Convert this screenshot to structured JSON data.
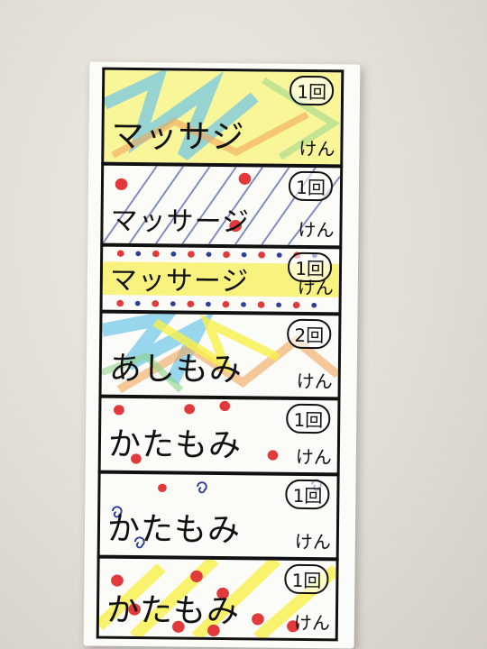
{
  "coupons": [
    {
      "text": "マッサジ",
      "suffix": "けん",
      "count": "1回"
    },
    {
      "text": "マッサージ",
      "suffix": "けん",
      "count": "1回"
    },
    {
      "text": "マッサージ",
      "suffix": "けん",
      "count": "1回"
    },
    {
      "text": "あしもみ",
      "suffix": "けん",
      "count": "2回"
    },
    {
      "text": "かたもみ",
      "suffix": "けん",
      "count": "1回"
    },
    {
      "text": "かたもみ",
      "suffix": "けん",
      "count": "1回"
    },
    {
      "text": "かたもみ",
      "suffix": "けん",
      "count": "1回"
    }
  ],
  "colors": {
    "yellow": "#f7f04a",
    "blue": "#6ec6e8",
    "orange": "#f2a65a",
    "red": "#e23a3a",
    "navy": "#2d3f9a",
    "ink": "#111111"
  }
}
